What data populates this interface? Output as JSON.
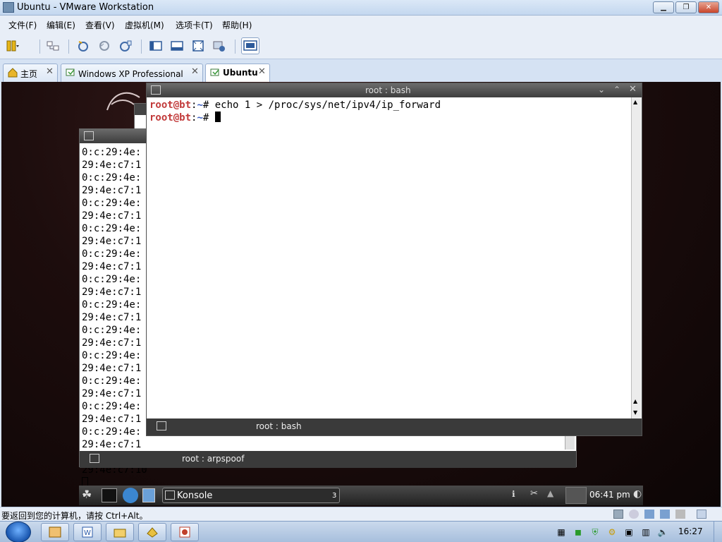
{
  "window": {
    "title": "Ubuntu - VMware Workstation"
  },
  "menu": [
    "文件(F)",
    "编辑(E)",
    "查看(V)",
    "虚拟机(M)",
    "选项卡(T)",
    "帮助(H)"
  ],
  "tabs": [
    {
      "label": "主页"
    },
    {
      "label": "Windows XP Professional（Te..."
    },
    {
      "label": "Ubuntu"
    }
  ],
  "vm": {
    "konsole_main": {
      "title": "root : bash",
      "status_tab": "root : bash",
      "lines": [
        {
          "user": "root@bt",
          "sep": ":",
          "dir": "~",
          "cmd": "# echo 1 > /proc/sys/net/ipv4/ip_forward"
        },
        {
          "user": "root@bt",
          "sep": ":",
          "dir": "~",
          "cmd": "# "
        }
      ]
    },
    "konsole_back": {
      "status_tab": "root : arpspoof",
      "lines": [
        "0:c:29:4e:",
        "29:4e:c7:1",
        "0:c:29:4e:",
        "29:4e:c7:1",
        "0:c:29:4e:",
        "29:4e:c7:1",
        "0:c:29:4e:",
        "29:4e:c7:1",
        "0:c:29:4e:",
        "29:4e:c7:1",
        "0:c:29:4e:",
        "29:4e:c7:1",
        "0:c:29:4e:",
        "29:4e:c7:1",
        "0:c:29:4e:",
        "29:4e:c7:1",
        "0:c:29:4e:",
        "29:4e:c7:1",
        "0:c:29:4e:",
        "29:4e:c7:1",
        "0:c:29:4e:",
        "29:4e:c7:1",
        "0:c:29:4e:",
        "29:4e:c7:1",
        "0:c:29:4e:",
        "29:4e:c7:10"
      ]
    },
    "panel": {
      "task_label": "Konsole",
      "task_count": "3",
      "clock": "06:41 pm"
    }
  },
  "status_message": "要返回到您的计算机，请按 Ctrl+Alt。",
  "taskbar": {
    "clock": "16:27"
  },
  "colors": {
    "accent": "#3b6db3",
    "prompt_user": "#c23b3b",
    "prompt_dir": "#3b5ec2"
  }
}
